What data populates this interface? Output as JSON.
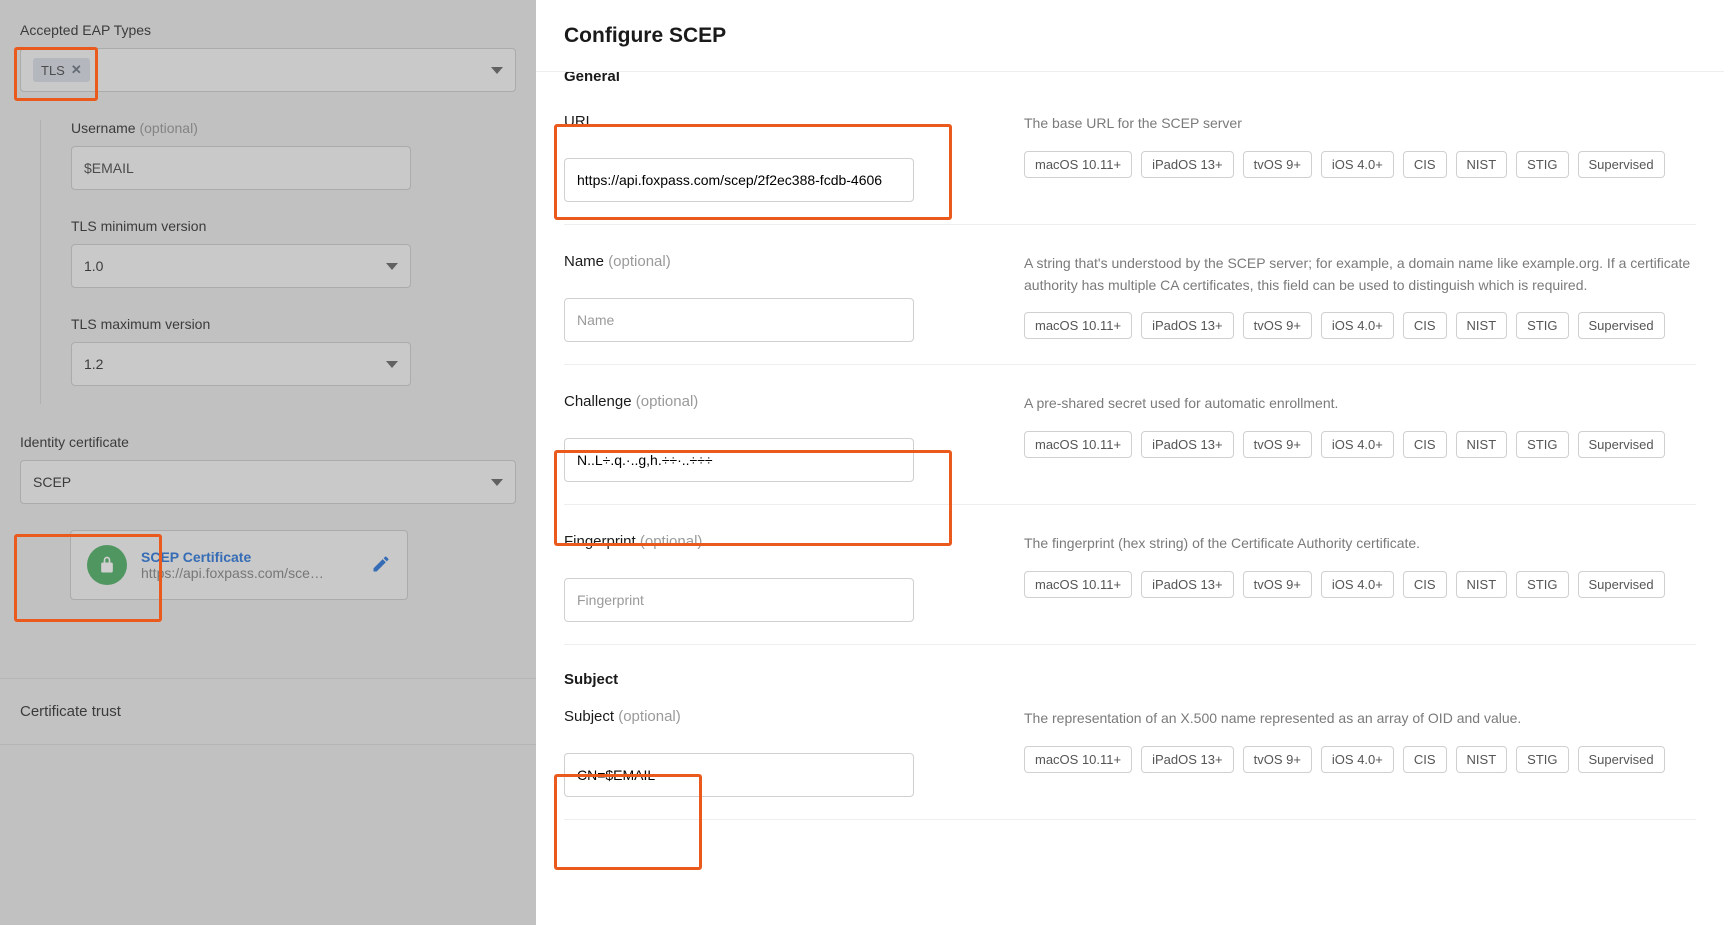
{
  "left": {
    "eap_types_label": "Accepted EAP Types",
    "eap_chip": "TLS",
    "username_label": "Username",
    "username_optional": "(optional)",
    "username_value": "$EMAIL",
    "tls_min_label": "TLS minimum version",
    "tls_min_value": "1.0",
    "tls_max_label": "TLS maximum version",
    "tls_max_value": "1.2",
    "identity_cert_label": "Identity certificate",
    "identity_cert_value": "SCEP",
    "scep_card_title": "SCEP Certificate",
    "scep_card_sub": "https://api.foxpass.com/sce…",
    "cert_trust_label": "Certificate trust"
  },
  "right": {
    "title": "Configure SCEP",
    "general_header": "General",
    "url": {
      "label": "URL",
      "value": "https://api.foxpass.com/scep/2f2ec388-fcdb-4606",
      "desc": "The base URL for the SCEP server"
    },
    "name": {
      "label": "Name",
      "optional": "(optional)",
      "placeholder": "Name",
      "desc": "A string that's understood by the SCEP server; for example, a domain name like example.org. If a certificate authority has multiple CA certificates, this field can be used to distinguish which is required."
    },
    "challenge": {
      "label": "Challenge",
      "optional": "(optional)",
      "masked": "N..L÷.q.·..g,h.÷÷·..÷÷÷",
      "desc": "A pre-shared secret used for automatic enrollment."
    },
    "fingerprint": {
      "label": "Fingerprint",
      "optional": "(optional)",
      "placeholder": "Fingerprint",
      "desc": "The fingerprint (hex string) of the Certificate Authority certificate."
    },
    "subject_header": "Subject",
    "subject": {
      "label": "Subject",
      "optional": "(optional)",
      "value": "CN=$EMAIL",
      "desc": "The representation of an X.500 name represented as an array of OID and value."
    },
    "tags": [
      "macOS 10.11+",
      "iPadOS 13+",
      "tvOS 9+",
      "iOS 4.0+",
      "CIS",
      "NIST",
      "STIG",
      "Supervised"
    ]
  }
}
